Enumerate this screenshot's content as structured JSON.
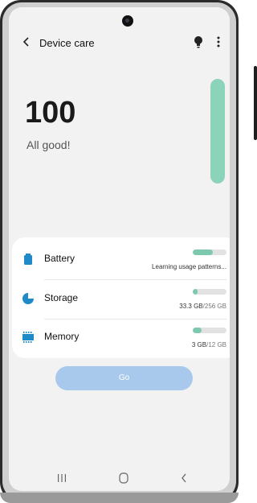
{
  "header": {
    "title": "Device care",
    "icons": [
      "back-icon",
      "bulb-icon",
      "more-icon"
    ]
  },
  "score": {
    "value": "100",
    "label": "All good!",
    "gauge_level_percent": 100
  },
  "items": [
    {
      "label": "Battery",
      "detail": "Learning usage patterns...",
      "bar_fill_percent": 60,
      "icon": "battery-icon"
    },
    {
      "label": "Storage",
      "detail_used": "33.3 GB",
      "detail_total": "/256 GB",
      "bar_fill_percent": 14,
      "icon": "storage-icon"
    },
    {
      "label": "Memory",
      "detail_used": "3 GB",
      "detail_total": "/12 GB",
      "bar_fill_percent": 25,
      "icon": "memory-icon"
    }
  ],
  "actions": {
    "go_label": "Go"
  },
  "navbar": {
    "icons": [
      "recent-apps-icon",
      "home-icon",
      "back-icon"
    ]
  },
  "colors": {
    "accent_green": "#7dc9ae",
    "button_blue": "#a9c9ec",
    "icon_blue": "#1e8ac8"
  }
}
